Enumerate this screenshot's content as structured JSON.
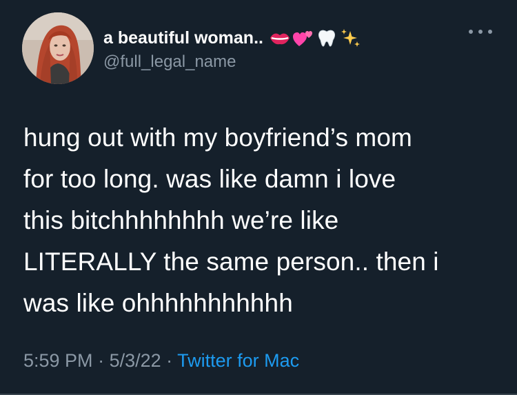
{
  "user": {
    "display_name": "a beautiful woman..",
    "emoji_icons": [
      "lips-icon",
      "two-hearts-icon",
      "tooth-icon",
      "sparkles-icon"
    ],
    "handle": "@full_legal_name"
  },
  "tweet": {
    "text": "hung out with my boyfriend’s mom\nfor too long. was like damn i love\nthis bitchhhhhhhh we’re like\nLITERALLY the same person.. then i\nwas like ohhhhhhhhhhh"
  },
  "meta": {
    "time": "5:59 PM",
    "separator": " · ",
    "date": "5/3/22",
    "source": "Twitter for Mac"
  },
  "colors": {
    "background": "#15202b",
    "primary_text": "#ffffff",
    "secondary_text": "#8b98a5",
    "link": "#1d9bf0"
  }
}
